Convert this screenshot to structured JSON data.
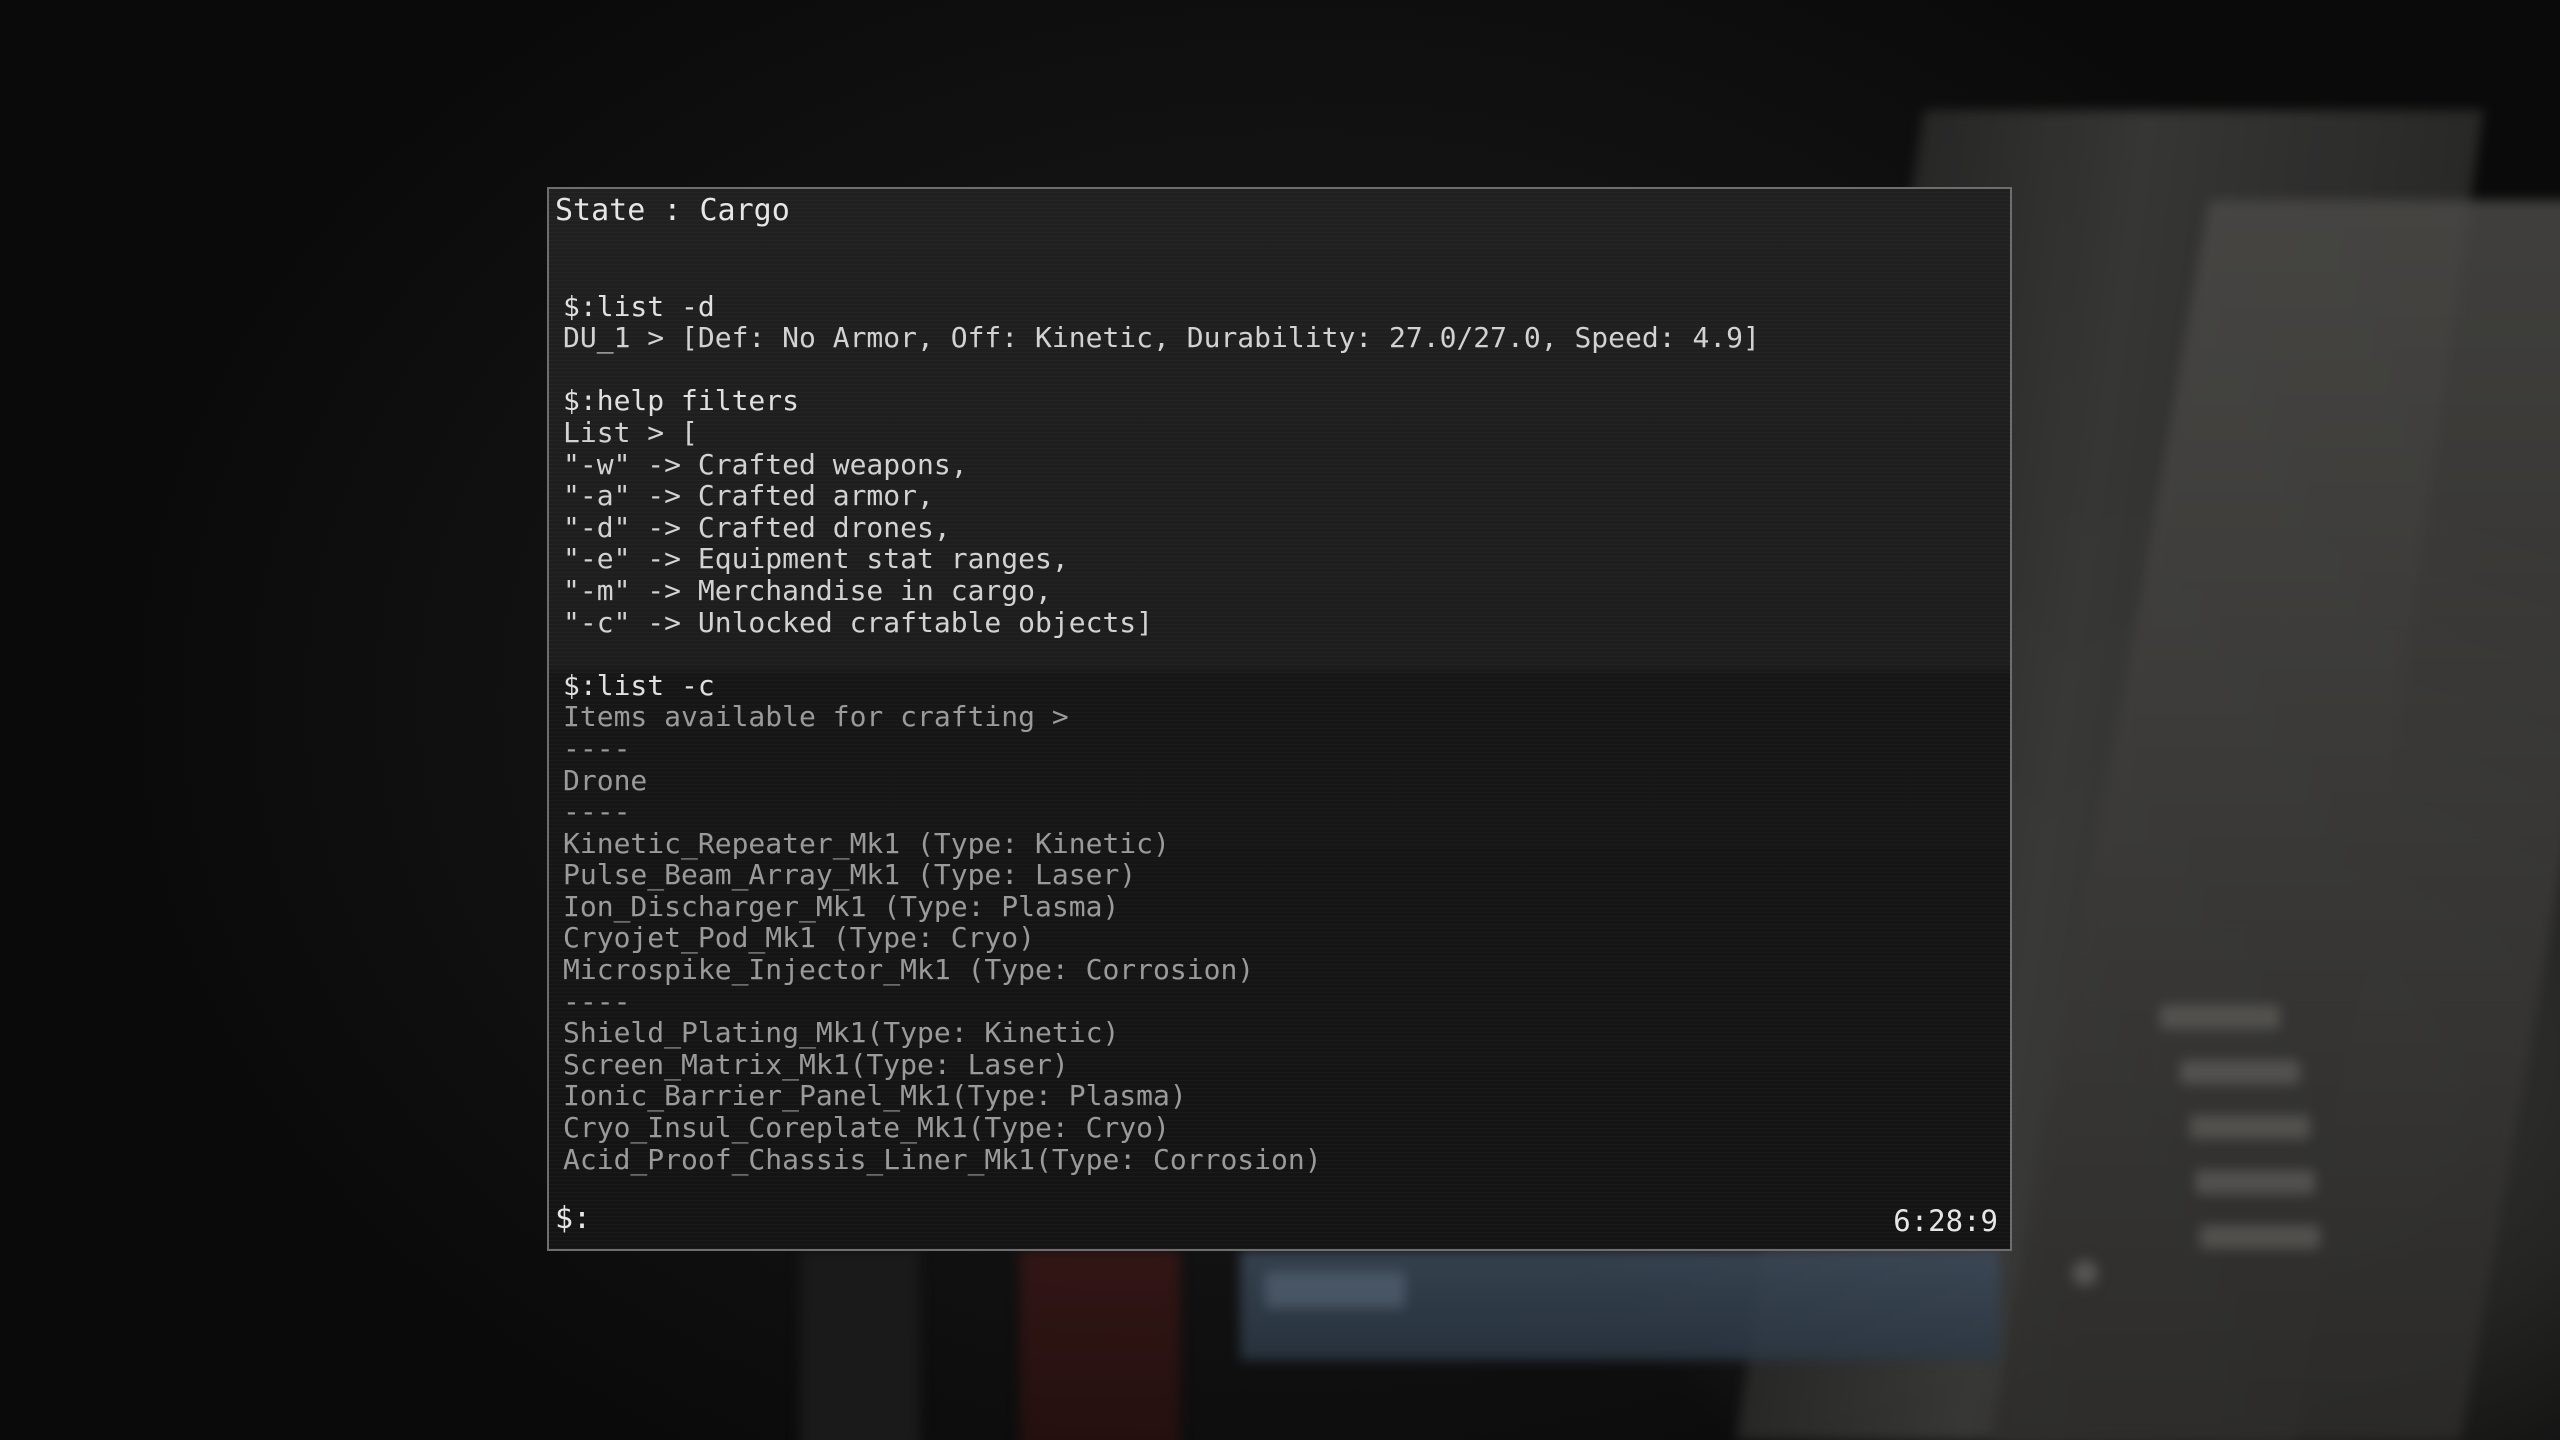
{
  "terminal": {
    "state": "State : Cargo",
    "lines": [
      {
        "text": "",
        "kind": "blank"
      },
      {
        "text": "$:list -d",
        "kind": "cmd"
      },
      {
        "text": "DU_1 > [Def: No Armor, Off: Kinetic, Durability: 27.0/27.0, Speed: 4.9]",
        "kind": "out"
      },
      {
        "text": "",
        "kind": "blank"
      },
      {
        "text": "$:help filters",
        "kind": "cmd"
      },
      {
        "text": "List > [",
        "kind": "out"
      },
      {
        "text": "\"-w\" -> Crafted weapons,",
        "kind": "out"
      },
      {
        "text": "\"-a\" -> Crafted armor,",
        "kind": "out"
      },
      {
        "text": "\"-d\" -> Crafted drones,",
        "kind": "out"
      },
      {
        "text": "\"-e\" -> Equipment stat ranges,",
        "kind": "out"
      },
      {
        "text": "\"-m\" -> Merchandise in cargo,",
        "kind": "out"
      },
      {
        "text": "\"-c\" -> Unlocked craftable objects]",
        "kind": "out"
      },
      {
        "text": "",
        "kind": "blank"
      },
      {
        "text": "$:list -c",
        "kind": "cmd"
      },
      {
        "text": "Items available for crafting >",
        "kind": "dim"
      },
      {
        "text": "----",
        "kind": "dim"
      },
      {
        "text": "Drone",
        "kind": "dim"
      },
      {
        "text": "----",
        "kind": "dim"
      },
      {
        "text": "Kinetic_Repeater_Mk1 (Type: Kinetic)",
        "kind": "dim"
      },
      {
        "text": "Pulse_Beam_Array_Mk1 (Type: Laser)",
        "kind": "dim"
      },
      {
        "text": "Ion_Discharger_Mk1 (Type: Plasma)",
        "kind": "dim"
      },
      {
        "text": "Cryojet_Pod_Mk1 (Type: Cryo)",
        "kind": "dim"
      },
      {
        "text": "Microspike_Injector_Mk1 (Type: Corrosion)",
        "kind": "dim"
      },
      {
        "text": "----",
        "kind": "dim"
      },
      {
        "text": "Shield_Plating_Mk1(Type: Kinetic)",
        "kind": "dim"
      },
      {
        "text": "Screen_Matrix_Mk1(Type: Laser)",
        "kind": "dim"
      },
      {
        "text": "Ionic_Barrier_Panel_Mk1(Type: Plasma)",
        "kind": "dim"
      },
      {
        "text": "Cryo_Insul_Coreplate_Mk1(Type: Cryo)",
        "kind": "dim"
      },
      {
        "text": "Acid_Proof_Chassis_Liner_Mk1(Type: Corrosion)",
        "kind": "dim"
      }
    ],
    "prompt": "$:",
    "clock": "6:28:9"
  },
  "colors": {
    "terminal_bg": "#1d1d1d",
    "terminal_border": "#6e6e6e",
    "text_bright": "#e0e0e0",
    "text_dim": "#9a9a9a"
  }
}
